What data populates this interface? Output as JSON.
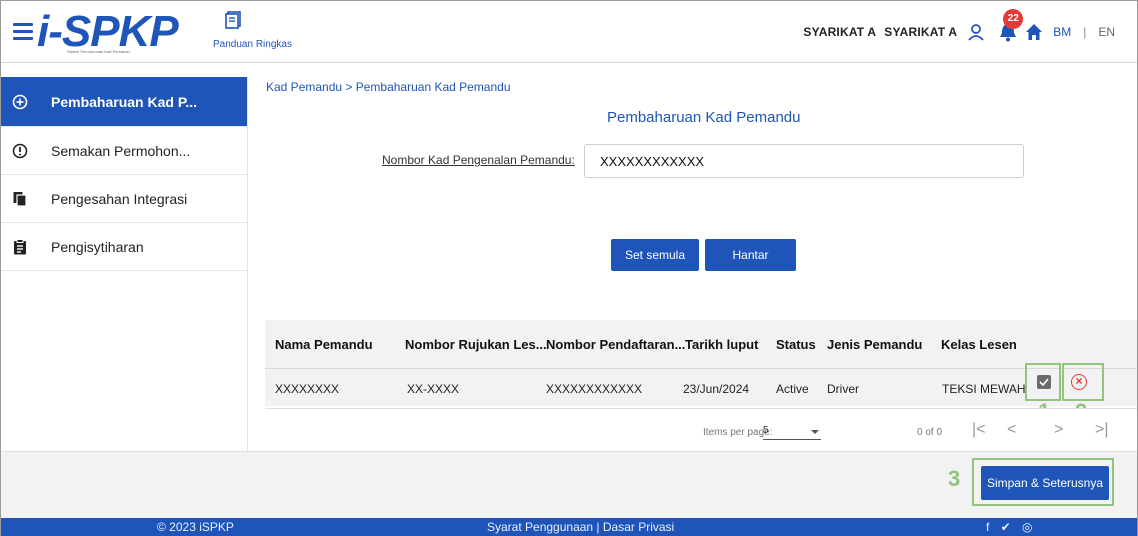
{
  "header": {
    "logo_text": "i-SPKP",
    "logo_tagline": "Sistem Permohonan Kad Pemandu",
    "guide_label": "Panduan Ringkas",
    "company_1": "SYARIKAT A",
    "company_2": "SYARIKAT A",
    "notification_count": "22",
    "lang_bm": "BM",
    "lang_sep": "|",
    "lang_en": "EN"
  },
  "sidebar": {
    "items": [
      {
        "label": "Pembaharuan Kad P...",
        "icon": "plus-circle-icon",
        "active": true
      },
      {
        "label": "Semakan Permohon...",
        "icon": "alert-circle-icon",
        "active": false
      },
      {
        "label": "Pengesahan Integrasi",
        "icon": "copy-document-icon",
        "active": false
      },
      {
        "label": "Pengisytiharan",
        "icon": "clipboard-icon",
        "active": false
      }
    ]
  },
  "main": {
    "breadcrumb": "Kad Pemandu > Pembaharuan Kad Pemandu",
    "title": "Pembaharuan Kad Pemandu",
    "ic_label": "Nombor Kad Pengenalan Pemandu:",
    "ic_value": "XXXXXXXXXXXX",
    "btn_reset": "Set semula",
    "btn_submit": "Hantar"
  },
  "table": {
    "headers": [
      "Nama Pemandu",
      "Nombor Rujukan Les...",
      "Nombor Pendaftaran...",
      "Tarikh luput",
      "Status",
      "Jenis Pemandu",
      "Kelas Lesen"
    ],
    "rows": [
      [
        "XXXXXXXX",
        "XX-XXXX",
        "XXXXXXXXXXXX",
        "23/Jun/2024",
        "Active",
        "Driver",
        "TEKSI MEWAH"
      ]
    ],
    "items_per_page_label": "Items per page:",
    "items_per_page_value": "5",
    "range_label": "0 of 0",
    "first": "|<",
    "prev": "<",
    "next": ">",
    "last": ">|"
  },
  "annotations": {
    "one": "1",
    "two": "2",
    "three": "3",
    "color": "#93c47d"
  },
  "actions": {
    "next_label": "Simpan & Seterusnya"
  },
  "footer": {
    "copyright": "© 2023 iSPKP",
    "links": "Syarat Penggunaan | Dasar Privasi",
    "social": "f ✔ ◎"
  },
  "colors": {
    "primary": "#1f55b8",
    "danger": "#e53935"
  }
}
